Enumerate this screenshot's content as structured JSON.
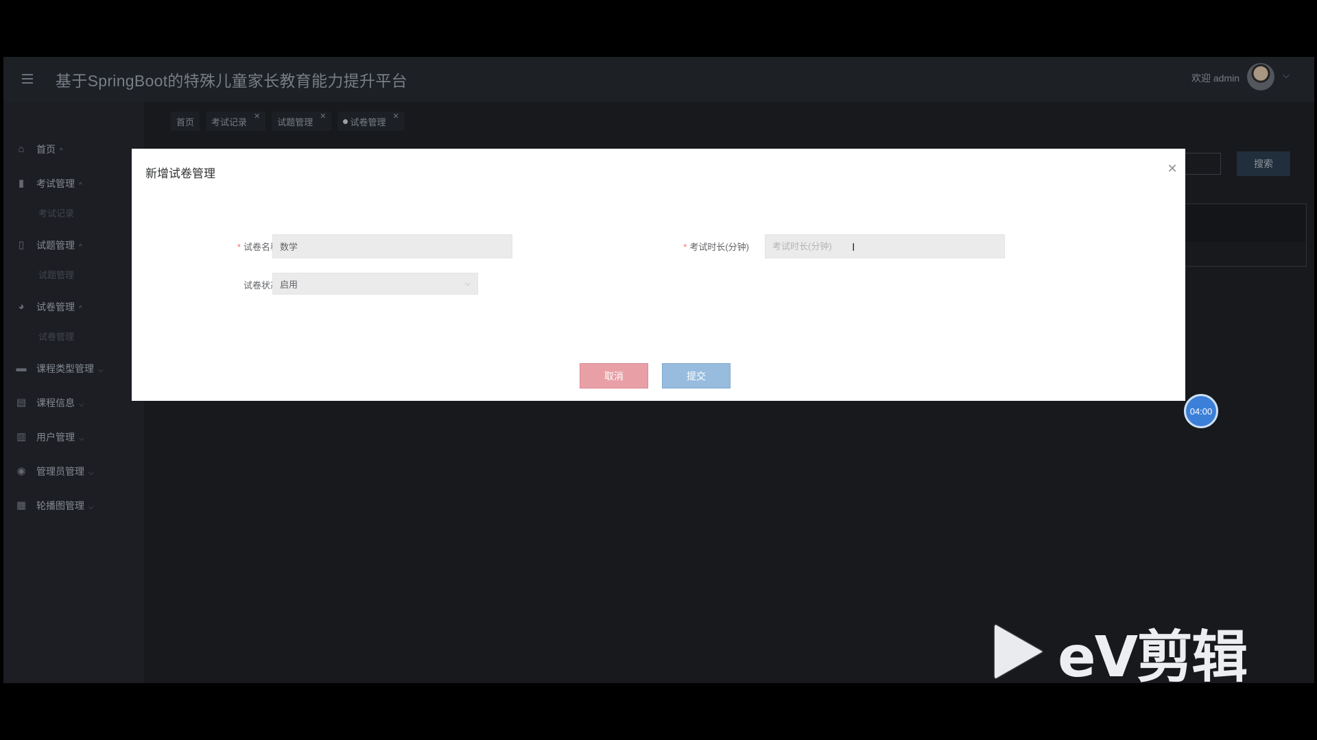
{
  "header": {
    "title": "基于SpringBoot的特殊儿童家长教育能力提升平台",
    "welcome": "欢迎 admin"
  },
  "sidebar": {
    "items": [
      {
        "label": "首页",
        "icon": "home-icon"
      },
      {
        "label": "考试管理",
        "icon": "book-icon",
        "sub": "考试记录"
      },
      {
        "label": "试题管理",
        "icon": "clipboard-icon",
        "sub": "试题管理"
      },
      {
        "label": "试卷管理",
        "icon": "gauge-icon",
        "sub": "试卷管理"
      },
      {
        "label": "课程类型管理",
        "icon": "briefcase-icon"
      },
      {
        "label": "课程信息",
        "icon": "notebook-icon"
      },
      {
        "label": "用户管理",
        "icon": "columns-icon"
      },
      {
        "label": "管理员管理",
        "icon": "disc-icon"
      },
      {
        "label": "轮播图管理",
        "icon": "layout-icon"
      }
    ]
  },
  "tags": [
    {
      "label": "首页"
    },
    {
      "label": "考试记录"
    },
    {
      "label": "试题管理"
    },
    {
      "label": "试卷管理"
    }
  ],
  "background": {
    "search_button": "搜索"
  },
  "modal": {
    "title": "新增试卷管理",
    "name_label": "试卷名称",
    "name_value": "数学",
    "duration_label": "考试时长(分钟)",
    "duration_placeholder": "考试时长(分钟)",
    "status_label": "试卷状态",
    "status_value": "启用",
    "cancel": "取消",
    "submit": "提交"
  },
  "timer": "04:00",
  "watermark": "eV剪辑",
  "colors": {
    "modal_bg": "#ffffff",
    "cancel_btn": "#e8a0a6",
    "submit_btn": "#97bcde",
    "timer": "#3b7fd8",
    "required": "#f56c6c"
  }
}
